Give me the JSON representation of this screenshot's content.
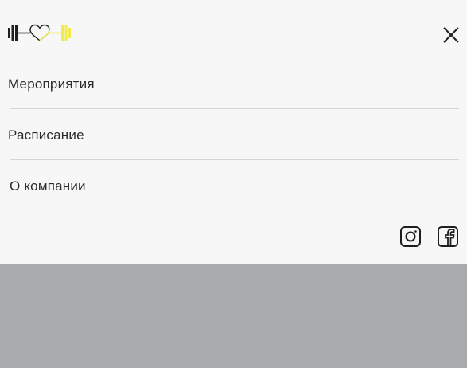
{
  "brand": {
    "logo_icon": "dumbbell-heart-logo",
    "colors": {
      "dark": "#1f1f1f",
      "accent": "#f2e94e"
    }
  },
  "header": {
    "close_icon": "close-icon"
  },
  "nav": {
    "items": [
      {
        "label": "Мероприятия"
      },
      {
        "label": "Расписание"
      },
      {
        "label": "О компании"
      }
    ]
  },
  "social": {
    "icons": [
      "instagram-icon",
      "facebook-icon"
    ]
  },
  "colors": {
    "menu_background": "#f7f7f7",
    "overlay": "#a8aaac",
    "divider": "#d6d6d6",
    "text": "#2b2b2b"
  }
}
